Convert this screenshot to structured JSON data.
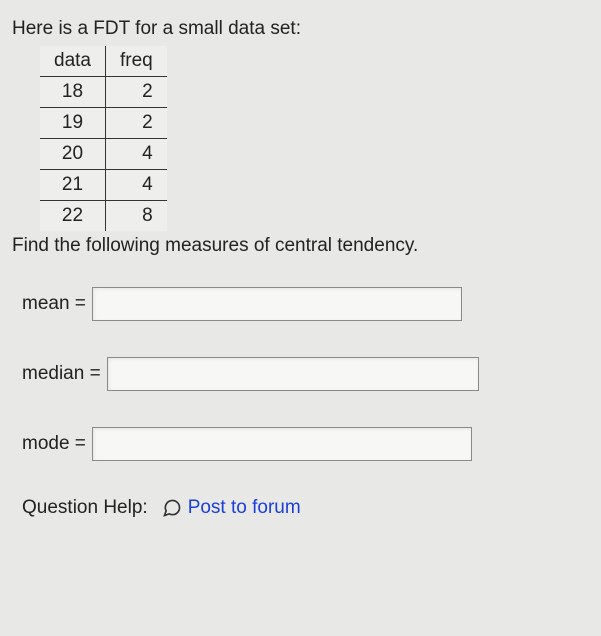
{
  "intro": "Here is a FDT for a small data set:",
  "table": {
    "headers": {
      "data": "data",
      "freq": "freq"
    },
    "rows": [
      {
        "data": "18",
        "freq": "2"
      },
      {
        "data": "19",
        "freq": "2"
      },
      {
        "data": "20",
        "freq": "4"
      },
      {
        "data": "21",
        "freq": "4"
      },
      {
        "data": "22",
        "freq": "8"
      }
    ]
  },
  "prompt2": "Find the following measures of central tendency.",
  "answers": {
    "mean": {
      "label": "mean =",
      "value": ""
    },
    "median": {
      "label": "median =",
      "value": ""
    },
    "mode": {
      "label": "mode =",
      "value": ""
    }
  },
  "help": {
    "label": "Question Help:",
    "link_text": "Post to forum"
  },
  "chart_data": {
    "type": "table",
    "columns": [
      "data",
      "freq"
    ],
    "rows": [
      [
        18,
        2
      ],
      [
        19,
        2
      ],
      [
        20,
        4
      ],
      [
        21,
        4
      ],
      [
        22,
        8
      ]
    ]
  }
}
